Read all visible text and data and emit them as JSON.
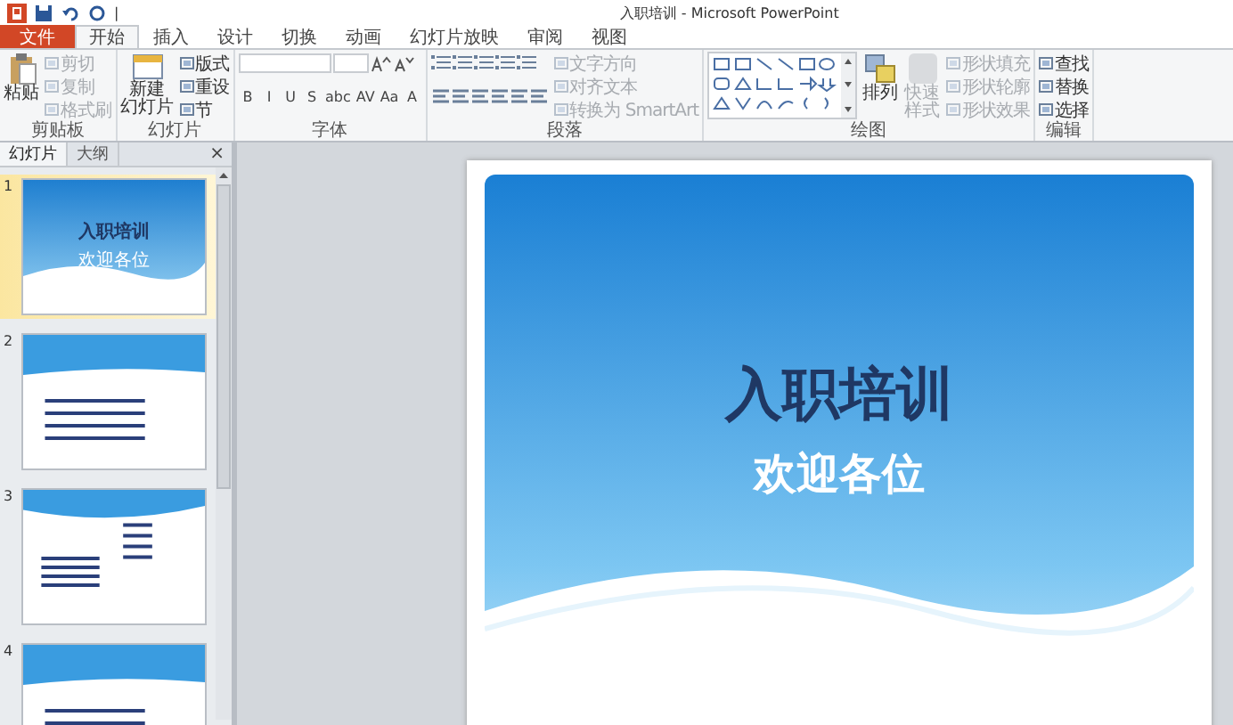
{
  "window": {
    "title": "入职培训 - Microsoft PowerPoint"
  },
  "quick_access": {
    "separator": "|"
  },
  "tabs": [
    {
      "label": "文件",
      "kind": "file",
      "selected": false
    },
    {
      "label": "开始",
      "kind": "tab",
      "selected": true
    },
    {
      "label": "插入",
      "kind": "tab",
      "selected": false
    },
    {
      "label": "设计",
      "kind": "tab",
      "selected": false
    },
    {
      "label": "切换",
      "kind": "tab",
      "selected": false
    },
    {
      "label": "动画",
      "kind": "tab",
      "selected": false
    },
    {
      "label": "幻灯片放映",
      "kind": "tab",
      "selected": false
    },
    {
      "label": "审阅",
      "kind": "tab",
      "selected": false
    },
    {
      "label": "视图",
      "kind": "tab",
      "selected": false
    }
  ],
  "ribbon": {
    "groups": [
      {
        "kind": "clipboard",
        "label": "剪贴板",
        "big": {
          "label": "粘贴"
        },
        "items": [
          {
            "label": "剪切",
            "disabled": true
          },
          {
            "label": "复制",
            "disabled": true
          },
          {
            "label": "格式刷",
            "disabled": true
          }
        ]
      },
      {
        "kind": "slides",
        "label": "幻灯片",
        "big": {
          "label": "新建",
          "label2": "幻灯片"
        },
        "items": [
          {
            "label": "版式",
            "disabled": false
          },
          {
            "label": "重设",
            "disabled": false
          },
          {
            "label": "节",
            "disabled": false
          }
        ]
      },
      {
        "kind": "font",
        "label": "字体",
        "glyphs": [
          "B",
          "I",
          "U",
          "S",
          "abc",
          "AV",
          "Aa",
          "A"
        ]
      },
      {
        "kind": "paragraph",
        "label": "段落",
        "items": [
          {
            "label": "文字方向",
            "disabled": true
          },
          {
            "label": "对齐文本",
            "disabled": true
          },
          {
            "label": "转换为 SmartArt",
            "disabled": true
          }
        ]
      },
      {
        "kind": "drawing",
        "label": "绘图",
        "big": {
          "label": "排列"
        },
        "big2": {
          "label": "快速样式",
          "disabled": true
        },
        "items": [
          {
            "label": "形状填充",
            "disabled": true
          },
          {
            "label": "形状轮廓",
            "disabled": true
          },
          {
            "label": "形状效果",
            "disabled": true
          }
        ]
      },
      {
        "kind": "editing",
        "label": "编辑",
        "items": [
          {
            "label": "查找",
            "disabled": false
          },
          {
            "label": "替换",
            "disabled": false
          },
          {
            "label": "选择",
            "disabled": false
          }
        ]
      }
    ]
  },
  "panel": {
    "tabs": [
      {
        "label": "幻灯片",
        "selected": true
      },
      {
        "label": "大纲",
        "selected": false
      }
    ],
    "close": "×"
  },
  "slides": [
    {
      "number": "1",
      "kind": "title",
      "selected": true,
      "title": "入职培训",
      "subtitle": "欢迎各位"
    },
    {
      "number": "2",
      "kind": "header",
      "selected": false
    },
    {
      "number": "3",
      "kind": "wave",
      "selected": false
    },
    {
      "number": "4",
      "kind": "header",
      "selected": false
    }
  ],
  "slide": {
    "title": "入职培训",
    "subtitle": "欢迎各位"
  }
}
